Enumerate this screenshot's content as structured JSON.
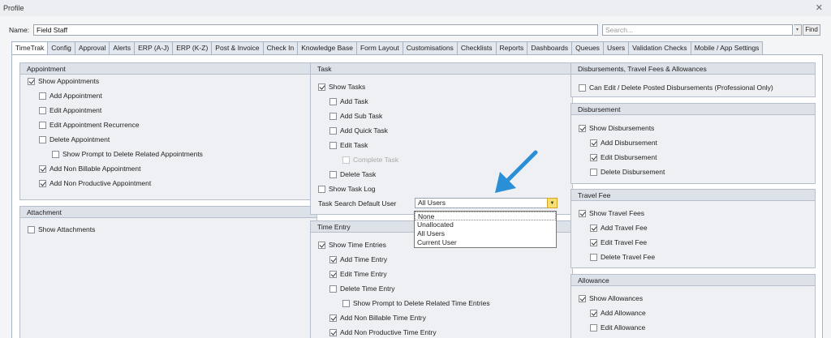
{
  "window": {
    "title": "Profile",
    "close_glyph": "✕"
  },
  "name_bar": {
    "label": "Name:",
    "value": "Field Staff",
    "search_placeholder": "Search...",
    "find_label": "Find",
    "dropdown_glyph": "▾"
  },
  "tabs": [
    {
      "label": "TimeTrak",
      "active": true
    },
    {
      "label": "Config"
    },
    {
      "label": "Approval"
    },
    {
      "label": "Alerts"
    },
    {
      "label": "ERP (A-J)"
    },
    {
      "label": "ERP (K-Z)"
    },
    {
      "label": "Post & Invoice"
    },
    {
      "label": "Check In"
    },
    {
      "label": "Knowledge Base"
    },
    {
      "label": "Form Layout"
    },
    {
      "label": "Customisations"
    },
    {
      "label": "Checklists"
    },
    {
      "label": "Reports"
    },
    {
      "label": "Dashboards"
    },
    {
      "label": "Queues"
    },
    {
      "label": "Users"
    },
    {
      "label": "Validation Checks"
    },
    {
      "label": "Mobile / App Settings"
    }
  ],
  "appointment": {
    "title": "Appointment",
    "items": [
      {
        "label": "Show Appointments",
        "checked": true
      },
      {
        "label": "Add Appointment",
        "checked": false
      },
      {
        "label": "Edit Appointment",
        "checked": false
      },
      {
        "label": "Edit Appointment Recurrence",
        "checked": false
      },
      {
        "label": "Delete Appointment",
        "checked": false
      },
      {
        "label": "Show Prompt to Delete Related Appointments",
        "checked": false
      },
      {
        "label": "Add Non Billable Appointment",
        "checked": true
      },
      {
        "label": "Add Non Productive Appointment",
        "checked": true
      }
    ]
  },
  "attachment": {
    "title": "Attachment",
    "items": [
      {
        "label": "Show Attachments",
        "checked": false
      }
    ]
  },
  "task": {
    "title": "Task",
    "items": [
      {
        "label": "Show Tasks",
        "checked": true
      },
      {
        "label": "Add Task",
        "checked": false
      },
      {
        "label": "Add Sub Task",
        "checked": false
      },
      {
        "label": "Add Quick Task",
        "checked": false
      },
      {
        "label": "Edit Task",
        "checked": false
      },
      {
        "label": "Complete Task",
        "checked": false,
        "disabled": true
      },
      {
        "label": "Delete Task",
        "checked": false
      },
      {
        "label": "Show Task Log",
        "checked": false
      }
    ],
    "default_user_label": "Task Search Default User",
    "default_user_value": "All Users",
    "default_user_options": [
      "None",
      "Unallocated",
      "All Users",
      "Current User"
    ]
  },
  "time_entry": {
    "title": "Time Entry",
    "items": [
      {
        "label": "Show Time Entries",
        "checked": true
      },
      {
        "label": "Add Time Entry",
        "checked": true
      },
      {
        "label": "Edit Time Entry",
        "checked": true
      },
      {
        "label": "Delete Time Entry",
        "checked": false
      },
      {
        "label": "Show Prompt to Delete Related Time Entries",
        "checked": false
      },
      {
        "label": "Add Non Billable Time Entry",
        "checked": true
      },
      {
        "label": "Add Non Productive Time Entry",
        "checked": true
      }
    ]
  },
  "disb_travel": {
    "title": "Disbursements, Travel Fees & Allowances",
    "items": [
      {
        "label": "Can Edit / Delete Posted Disbursements (Professional Only)",
        "checked": false
      }
    ]
  },
  "disbursement": {
    "title": "Disbursement",
    "items": [
      {
        "label": "Show Disbursements",
        "checked": true
      },
      {
        "label": "Add Disbursement",
        "checked": true
      },
      {
        "label": "Edit Disbursement",
        "checked": true
      },
      {
        "label": "Delete Disbursement",
        "checked": false
      }
    ]
  },
  "travel_fee": {
    "title": "Travel Fee",
    "items": [
      {
        "label": "Show Travel Fees",
        "checked": true
      },
      {
        "label": "Add Travel Fee",
        "checked": true
      },
      {
        "label": "Edit Travel Fee",
        "checked": true
      },
      {
        "label": "Delete Travel Fee",
        "checked": false
      }
    ]
  },
  "allowance": {
    "title": "Allowance",
    "items": [
      {
        "label": "Show Allowances",
        "checked": true
      },
      {
        "label": "Add Allowance",
        "checked": true
      },
      {
        "label": "Edit Allowance",
        "checked": false
      }
    ]
  },
  "colors": {
    "annotation_arrow": "#2a8fd6",
    "combo_button": "#f8e070"
  }
}
